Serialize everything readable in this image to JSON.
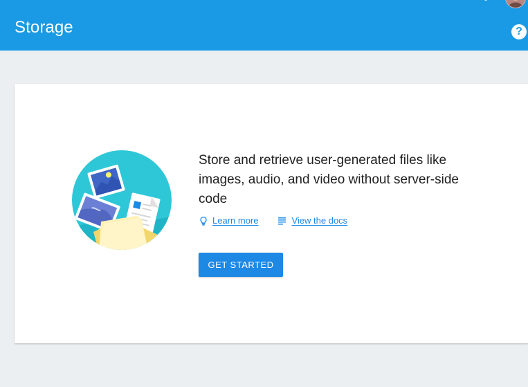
{
  "header": {
    "title": "Storage",
    "help_icon": "help-icon",
    "avatar_icon": "avatar"
  },
  "card": {
    "illustration": "storage-files-illustration",
    "description": "Store and retrieve user-generated files like images, audio, and video without server-side code",
    "learn_more_label": "Learn more",
    "learn_more_icon": "lightbulb-icon",
    "view_docs_label": "View the docs",
    "view_docs_icon": "docs-icon",
    "cta_label": "GET STARTED"
  },
  "colors": {
    "header_bg": "#1a9ae4",
    "page_bg": "#eceff1",
    "accent": "#1e88e5",
    "text": "#212121"
  }
}
